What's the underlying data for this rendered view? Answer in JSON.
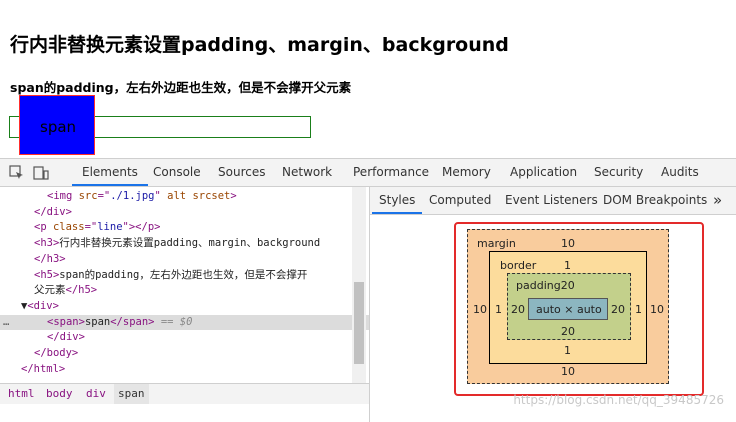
{
  "page": {
    "heading": "行内非替换元素设置padding、margin、background",
    "subheading": "span的padding，左右外边距也生效，但是不会撑开父元素",
    "span_text": "span"
  },
  "devtools": {
    "tabs": [
      "Elements",
      "Console",
      "Sources",
      "Network",
      "Performance",
      "Memory",
      "Application",
      "Security",
      "Audits"
    ],
    "active_tab": "Elements",
    "elements_lines": [
      {
        "indent": 3,
        "parts": [
          [
            "tag",
            "<img "
          ],
          [
            "attr",
            "src"
          ],
          [
            "tag",
            "=\""
          ],
          [
            "val",
            "./1.jpg"
          ],
          [
            "tag",
            "\" "
          ],
          [
            "attr",
            "alt srcset"
          ],
          [
            "tag",
            ">"
          ]
        ]
      },
      {
        "indent": 2,
        "parts": [
          [
            "tag",
            "</div>"
          ]
        ]
      },
      {
        "indent": 2,
        "parts": [
          [
            "tag",
            "<p "
          ],
          [
            "attr",
            "class"
          ],
          [
            "tag",
            "=\""
          ],
          [
            "val",
            "line"
          ],
          [
            "tag",
            "\"></p>"
          ]
        ]
      },
      {
        "indent": 2,
        "parts": [
          [
            "tag",
            "<h3>"
          ],
          [
            "text",
            "行内非替换元素设置padding、margin、background"
          ]
        ]
      },
      {
        "indent": 2,
        "parts": [
          [
            "tag",
            "</h3>"
          ]
        ]
      },
      {
        "indent": 2,
        "parts": [
          [
            "tag",
            "<h5>"
          ],
          [
            "text",
            "span的padding，左右外边距也生效，但是不会撑开"
          ]
        ]
      },
      {
        "indent": 2,
        "parts": [
          [
            "text",
            "父元素"
          ],
          [
            "tag",
            "</h5>"
          ]
        ]
      },
      {
        "indent": 1,
        "parts": [
          [
            "text",
            "▼"
          ],
          [
            "tag",
            "<div>"
          ]
        ]
      },
      {
        "indent": 3,
        "selected": true,
        "parts": [
          [
            "tag",
            "<span>"
          ],
          [
            "text",
            "span"
          ],
          [
            "tag",
            "</span>"
          ],
          [
            "attr",
            " == $0"
          ]
        ]
      },
      {
        "indent": 3,
        "parts": [
          [
            "tag",
            "</div>"
          ]
        ]
      },
      {
        "indent": 2,
        "parts": [
          [
            "tag",
            "</body>"
          ]
        ]
      },
      {
        "indent": 1,
        "parts": [
          [
            "tag",
            "</html>"
          ]
        ]
      }
    ],
    "breadcrumbs": [
      "html",
      "body",
      "div",
      "span"
    ],
    "styles_tabs": [
      "Styles",
      "Computed",
      "Event Listeners",
      "DOM Breakpoints"
    ],
    "more_tabs": "»",
    "box_model": {
      "margin_label": "margin",
      "margin_top": "10",
      "margin_bottom": "10",
      "margin_left": "10",
      "margin_right": "10",
      "border_label": "border",
      "border_top": "1",
      "border_bottom": "1",
      "border_left": "1",
      "border_right": "1",
      "padding_label": "padding20",
      "padding_bottom": "20",
      "padding_left": "20",
      "padding_right": "20",
      "content": "auto × auto"
    }
  },
  "watermark": "https://blog.csdn.net/qq_39485726",
  "colors": {
    "span_bg": "#0000ff",
    "margin": "#f9cc9d",
    "border": "#fcdc9c",
    "padding": "#c3d08b",
    "content": "#8cb6c0",
    "highlight_frame": "#e32a2a",
    "active_tab_underline": "#1a73e8"
  }
}
